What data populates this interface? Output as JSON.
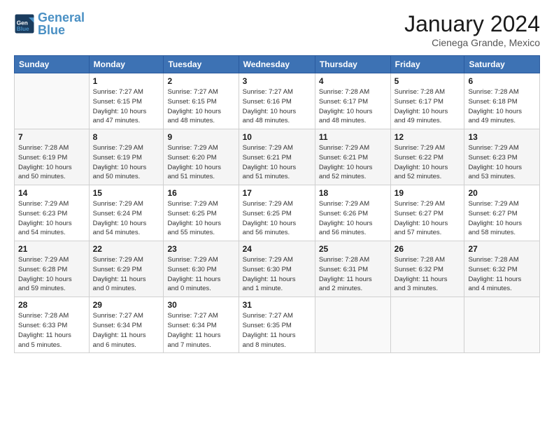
{
  "header": {
    "logo_general": "General",
    "logo_blue": "Blue",
    "month_title": "January 2024",
    "location": "Cienega Grande, Mexico"
  },
  "days_of_week": [
    "Sunday",
    "Monday",
    "Tuesday",
    "Wednesday",
    "Thursday",
    "Friday",
    "Saturday"
  ],
  "weeks": [
    [
      {
        "day": "",
        "info": ""
      },
      {
        "day": "1",
        "info": "Sunrise: 7:27 AM\nSunset: 6:15 PM\nDaylight: 10 hours\nand 47 minutes."
      },
      {
        "day": "2",
        "info": "Sunrise: 7:27 AM\nSunset: 6:15 PM\nDaylight: 10 hours\nand 48 minutes."
      },
      {
        "day": "3",
        "info": "Sunrise: 7:27 AM\nSunset: 6:16 PM\nDaylight: 10 hours\nand 48 minutes."
      },
      {
        "day": "4",
        "info": "Sunrise: 7:28 AM\nSunset: 6:17 PM\nDaylight: 10 hours\nand 48 minutes."
      },
      {
        "day": "5",
        "info": "Sunrise: 7:28 AM\nSunset: 6:17 PM\nDaylight: 10 hours\nand 49 minutes."
      },
      {
        "day": "6",
        "info": "Sunrise: 7:28 AM\nSunset: 6:18 PM\nDaylight: 10 hours\nand 49 minutes."
      }
    ],
    [
      {
        "day": "7",
        "info": "Sunrise: 7:28 AM\nSunset: 6:19 PM\nDaylight: 10 hours\nand 50 minutes."
      },
      {
        "day": "8",
        "info": "Sunrise: 7:29 AM\nSunset: 6:19 PM\nDaylight: 10 hours\nand 50 minutes."
      },
      {
        "day": "9",
        "info": "Sunrise: 7:29 AM\nSunset: 6:20 PM\nDaylight: 10 hours\nand 51 minutes."
      },
      {
        "day": "10",
        "info": "Sunrise: 7:29 AM\nSunset: 6:21 PM\nDaylight: 10 hours\nand 51 minutes."
      },
      {
        "day": "11",
        "info": "Sunrise: 7:29 AM\nSunset: 6:21 PM\nDaylight: 10 hours\nand 52 minutes."
      },
      {
        "day": "12",
        "info": "Sunrise: 7:29 AM\nSunset: 6:22 PM\nDaylight: 10 hours\nand 52 minutes."
      },
      {
        "day": "13",
        "info": "Sunrise: 7:29 AM\nSunset: 6:23 PM\nDaylight: 10 hours\nand 53 minutes."
      }
    ],
    [
      {
        "day": "14",
        "info": "Sunrise: 7:29 AM\nSunset: 6:23 PM\nDaylight: 10 hours\nand 54 minutes."
      },
      {
        "day": "15",
        "info": "Sunrise: 7:29 AM\nSunset: 6:24 PM\nDaylight: 10 hours\nand 54 minutes."
      },
      {
        "day": "16",
        "info": "Sunrise: 7:29 AM\nSunset: 6:25 PM\nDaylight: 10 hours\nand 55 minutes."
      },
      {
        "day": "17",
        "info": "Sunrise: 7:29 AM\nSunset: 6:25 PM\nDaylight: 10 hours\nand 56 minutes."
      },
      {
        "day": "18",
        "info": "Sunrise: 7:29 AM\nSunset: 6:26 PM\nDaylight: 10 hours\nand 56 minutes."
      },
      {
        "day": "19",
        "info": "Sunrise: 7:29 AM\nSunset: 6:27 PM\nDaylight: 10 hours\nand 57 minutes."
      },
      {
        "day": "20",
        "info": "Sunrise: 7:29 AM\nSunset: 6:27 PM\nDaylight: 10 hours\nand 58 minutes."
      }
    ],
    [
      {
        "day": "21",
        "info": "Sunrise: 7:29 AM\nSunset: 6:28 PM\nDaylight: 10 hours\nand 59 minutes."
      },
      {
        "day": "22",
        "info": "Sunrise: 7:29 AM\nSunset: 6:29 PM\nDaylight: 11 hours\nand 0 minutes."
      },
      {
        "day": "23",
        "info": "Sunrise: 7:29 AM\nSunset: 6:30 PM\nDaylight: 11 hours\nand 0 minutes."
      },
      {
        "day": "24",
        "info": "Sunrise: 7:29 AM\nSunset: 6:30 PM\nDaylight: 11 hours\nand 1 minute."
      },
      {
        "day": "25",
        "info": "Sunrise: 7:28 AM\nSunset: 6:31 PM\nDaylight: 11 hours\nand 2 minutes."
      },
      {
        "day": "26",
        "info": "Sunrise: 7:28 AM\nSunset: 6:32 PM\nDaylight: 11 hours\nand 3 minutes."
      },
      {
        "day": "27",
        "info": "Sunrise: 7:28 AM\nSunset: 6:32 PM\nDaylight: 11 hours\nand 4 minutes."
      }
    ],
    [
      {
        "day": "28",
        "info": "Sunrise: 7:28 AM\nSunset: 6:33 PM\nDaylight: 11 hours\nand 5 minutes."
      },
      {
        "day": "29",
        "info": "Sunrise: 7:27 AM\nSunset: 6:34 PM\nDaylight: 11 hours\nand 6 minutes."
      },
      {
        "day": "30",
        "info": "Sunrise: 7:27 AM\nSunset: 6:34 PM\nDaylight: 11 hours\nand 7 minutes."
      },
      {
        "day": "31",
        "info": "Sunrise: 7:27 AM\nSunset: 6:35 PM\nDaylight: 11 hours\nand 8 minutes."
      },
      {
        "day": "",
        "info": ""
      },
      {
        "day": "",
        "info": ""
      },
      {
        "day": "",
        "info": ""
      }
    ]
  ]
}
